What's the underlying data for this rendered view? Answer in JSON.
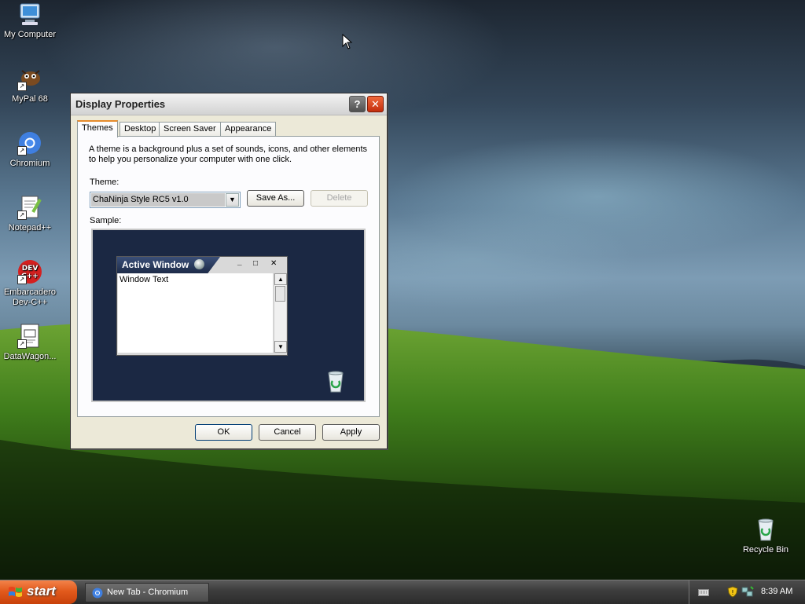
{
  "desktop": {
    "icons": [
      {
        "label": "My Computer"
      },
      {
        "label": "MyPal 68"
      },
      {
        "label": "Chromium"
      },
      {
        "label": "Notepad++"
      },
      {
        "label_line1": "Embarcadero",
        "label_line2": "Dev-C++"
      },
      {
        "label": "DataWagon..."
      },
      {
        "label": "Recycle Bin"
      }
    ]
  },
  "dialog": {
    "title": "Display Properties",
    "help_glyph": "?",
    "close_glyph": "✕",
    "tabs": [
      {
        "label": "Themes",
        "active": true
      },
      {
        "label": "Desktop"
      },
      {
        "label": "Screen Saver"
      },
      {
        "label": "Appearance"
      }
    ],
    "description": "A theme is a background plus a set of sounds, icons, and other elements to help you personalize your computer with one click.",
    "theme_label": "Theme:",
    "theme_value": "ChaNinja Style RC5 v1.0",
    "save_as_label": "Save As...",
    "delete_label": "Delete",
    "sample_label": "Sample:",
    "sample": {
      "window_title": "Active Window",
      "window_text": "Window Text",
      "minimize_glyph": "_",
      "maximize_glyph": "□",
      "close_glyph": "✕"
    },
    "ok_label": "OK",
    "cancel_label": "Cancel",
    "apply_label": "Apply"
  },
  "taskbar": {
    "start_label": "start",
    "items": [
      {
        "label": "New Tab - Chromium"
      }
    ],
    "clock": "8:39 AM"
  }
}
